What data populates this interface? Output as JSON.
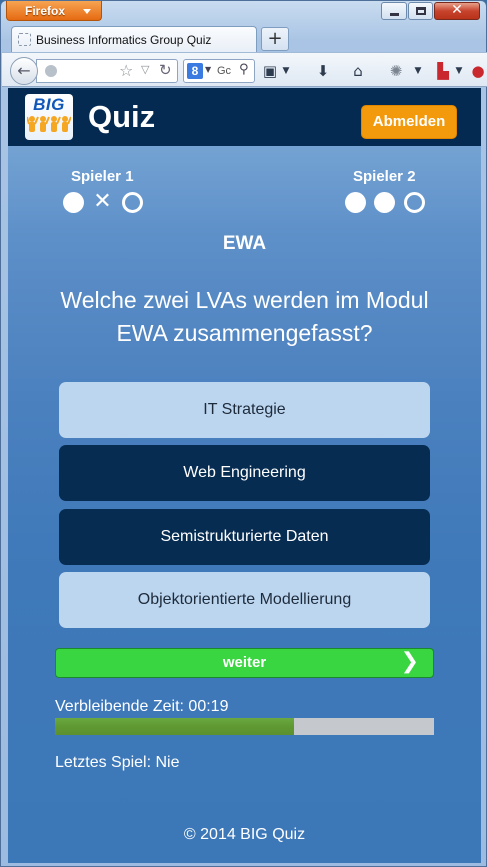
{
  "browser": {
    "menu_label": "Firefox",
    "tab_title": "Business Informatics Group Quiz",
    "new_tab_label": "+",
    "search_engine_letter": "8",
    "search_placeholder": "Gc"
  },
  "app": {
    "logo_text": "BIG",
    "title": "Quiz",
    "logout_label": "Abmelden"
  },
  "players": [
    {
      "name": "Spieler 1",
      "results": [
        "correct",
        "wrong",
        "open"
      ]
    },
    {
      "name": "Spieler 2",
      "results": [
        "correct",
        "correct",
        "open"
      ]
    }
  ],
  "quiz": {
    "category": "EWA",
    "question": "Welche zwei LVAs werden im Modul EWA zusammengefasst?",
    "answers": [
      {
        "label": "IT Strategie",
        "selected": false
      },
      {
        "label": "Web Engineering",
        "selected": true
      },
      {
        "label": "Semistrukturierte Daten",
        "selected": true
      },
      {
        "label": "Objektorientierte Modellierung",
        "selected": false
      }
    ],
    "next_label": "weiter",
    "timer_label": "Verbleibende Zeit: 00:19",
    "timer_progress": 0.63,
    "last_game": "Letztes Spiel: Nie"
  },
  "footer": "© 2014 BIG Quiz",
  "colors": {
    "header_bg": "#052a51",
    "logout_bg": "#f39a0c",
    "answer_selected": "#062c52",
    "answer_unselected": "#bcd6f0",
    "next_bg": "#3ad642",
    "timer_fill": "#5f9932"
  }
}
